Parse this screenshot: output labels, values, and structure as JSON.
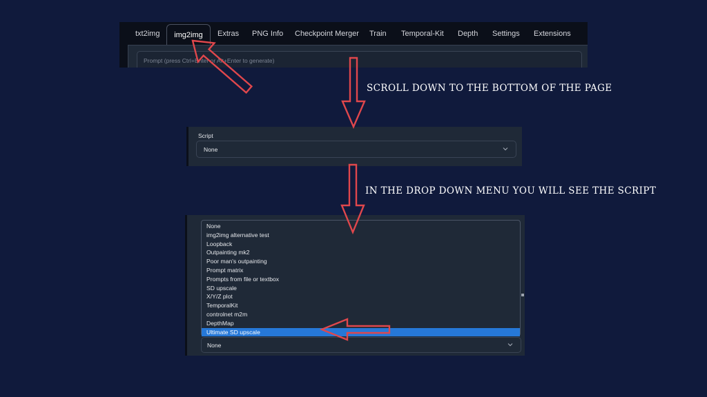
{
  "tabs": [
    {
      "label": "txt2img",
      "active": false
    },
    {
      "label": "img2img",
      "active": true
    },
    {
      "label": "Extras",
      "active": false
    },
    {
      "label": "PNG Info",
      "active": false
    },
    {
      "label": "Checkpoint Merger",
      "active": false
    },
    {
      "label": "Train",
      "active": false
    },
    {
      "label": "Temporal-Kit",
      "active": false
    },
    {
      "label": "Depth",
      "active": false
    },
    {
      "label": "Settings",
      "active": false
    },
    {
      "label": "Extensions",
      "active": false
    }
  ],
  "prompt": {
    "placeholder": "Prompt (press Ctrl+Enter or Alt+Enter to generate)"
  },
  "script_panel": {
    "label": "Script",
    "selected": "None"
  },
  "instructions": {
    "step1": "SCROLL DOWN TO THE BOTTOM OF THE PAGE",
    "step2": "IN THE DROP DOWN MENU YOU WILL SEE THE SCRIPT"
  },
  "script_options": [
    "None",
    "img2img alternative test",
    "Loopback",
    "Outpainting mk2",
    "Poor man's outpainting",
    "Prompt matrix",
    "Prompts from file or textbox",
    "SD upscale",
    "X/Y/Z plot",
    "TemporalKit",
    "controlnet m2m",
    "DepthMap",
    "Ultimate SD upscale"
  ],
  "highlighted_option": "Ultimate SD upscale",
  "list_select": {
    "selected": "None"
  },
  "colors": {
    "background": "#101a3c",
    "panel": "#1f2937",
    "highlight": "#2678d8",
    "arrow_outline": "#e0474c"
  },
  "icons": {
    "dropdown": "chevron-down-icon",
    "annotation": "arrow-icon"
  }
}
